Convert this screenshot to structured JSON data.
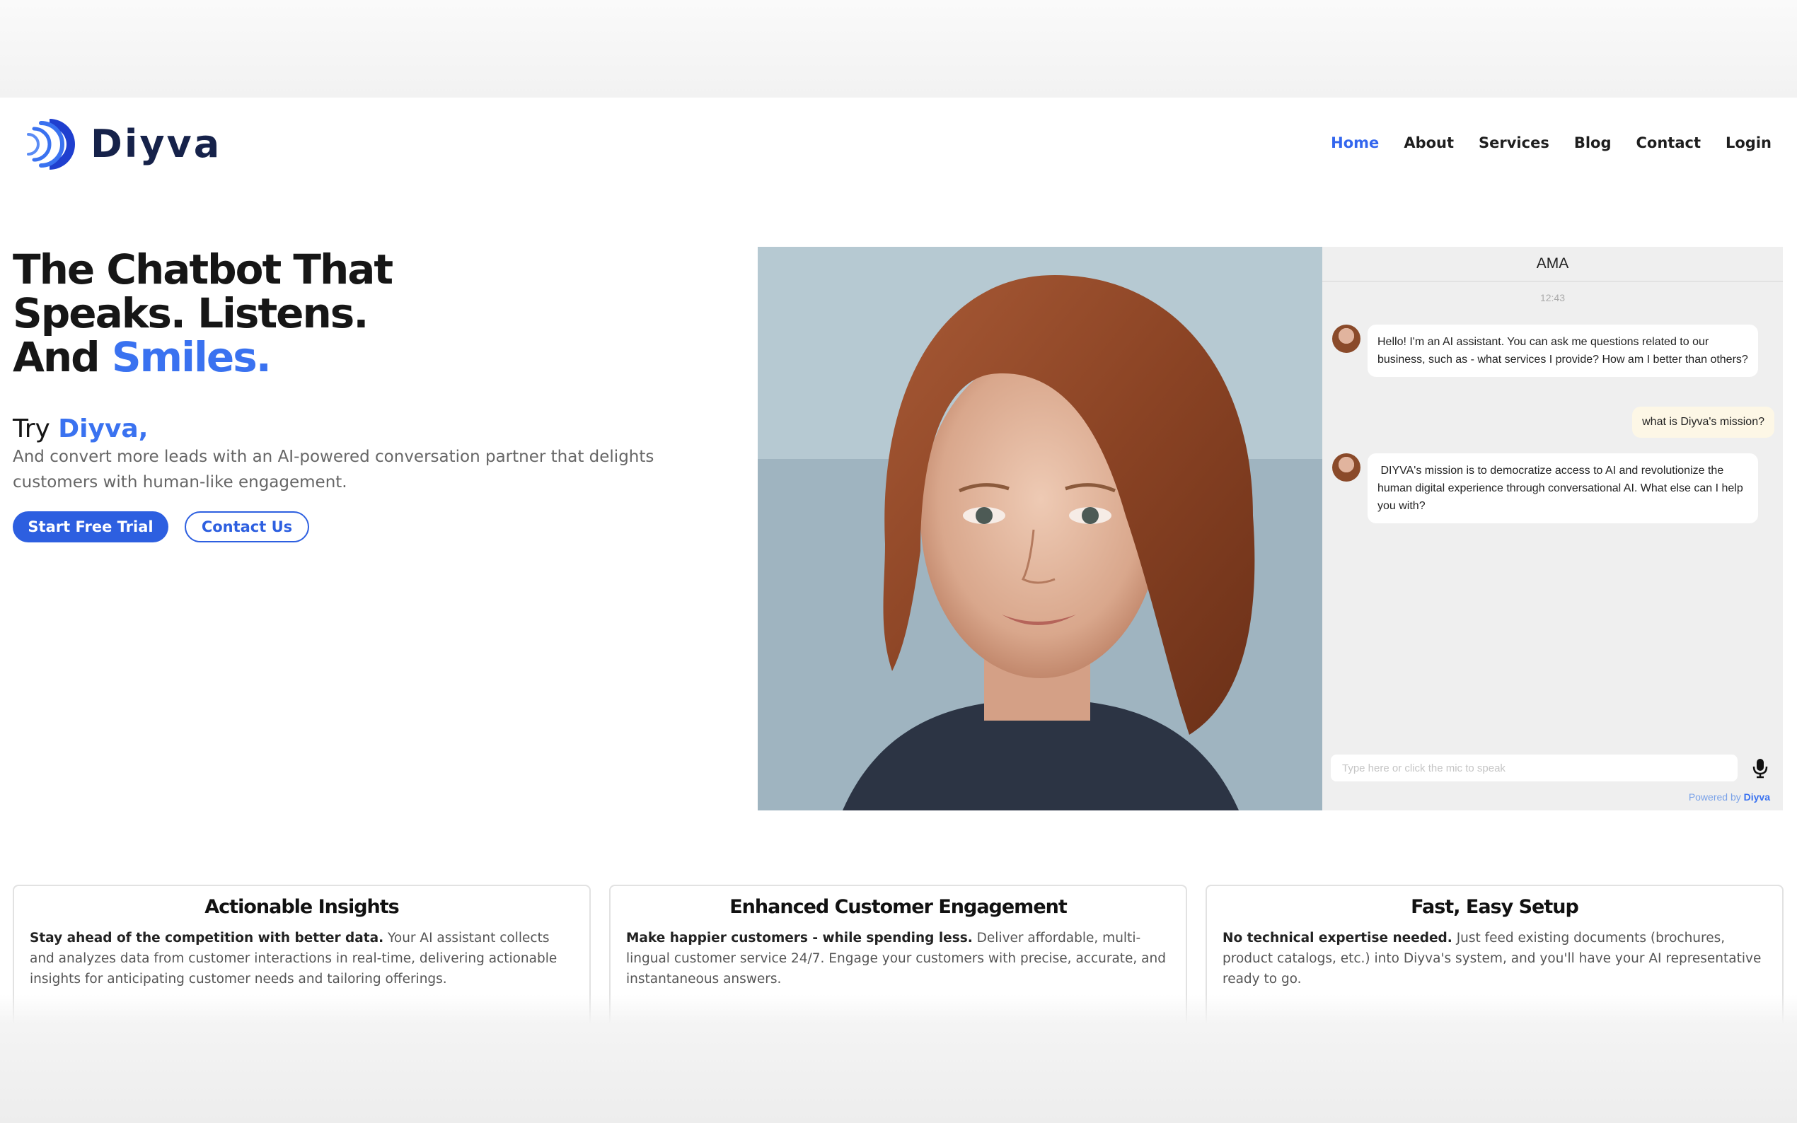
{
  "brand": {
    "name": "Diyva",
    "accent": "#3a72f0",
    "dark": "#16224a"
  },
  "nav": [
    {
      "label": "Home",
      "active": true
    },
    {
      "label": "About"
    },
    {
      "label": "Services"
    },
    {
      "label": "Blog"
    },
    {
      "label": "Contact"
    },
    {
      "label": "Login"
    }
  ],
  "hero": {
    "line1": "The Chatbot That",
    "line2": "Speaks. Listens.",
    "line3_prefix": "And ",
    "line3_accent": "Smiles.",
    "try_prefix": "Try ",
    "try_accent": "Diyva,",
    "subtitle": "And convert more leads with an AI-powered conversation partner that delights customers with human-like engagement.",
    "primary_button": "Start Free Trial",
    "secondary_button": "Contact Us"
  },
  "chat": {
    "title": "AMA",
    "time": "12:43",
    "bot_message_1": "Hello! I'm an AI assistant. You can ask me questions related to our business, such as - what services I provide? How am I better than others?",
    "user_message": "what is Diyva's mission?",
    "bot_message_2": " DIYVA's mission is to democratize access to AI and revolutionize the human digital experience through conversational AI. What else can I help you with?",
    "input_placeholder": "Type here or click the mic to speak",
    "powered_prefix": "Powered by ",
    "powered_brand": "Diyva"
  },
  "features": [
    {
      "title": "Actionable Insights",
      "lead": "Stay ahead of the competition with better data.",
      "body": " Your AI assistant collects and analyzes data from customer interactions in real-time, delivering actionable insights for anticipating customer needs and tailoring offerings."
    },
    {
      "title": "Enhanced Customer Engagement",
      "lead": "Make happier customers - while spending less.",
      "body": " Deliver affordable, multi-lingual customer service 24/7. Engage your customers with precise, accurate, and instantaneous answers."
    },
    {
      "title": "Fast, Easy Setup",
      "lead": "No technical expertise needed.",
      "body": " Just feed existing documents (brochures, product catalogs, etc.) into Diyva's system, and you'll have your AI representative ready to go."
    }
  ]
}
